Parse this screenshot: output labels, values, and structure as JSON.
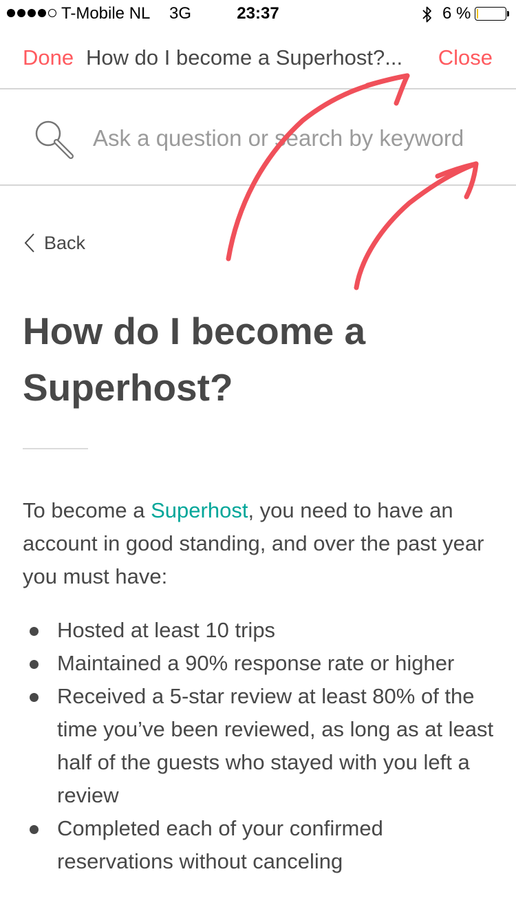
{
  "status_bar": {
    "carrier": "T-Mobile NL",
    "network": "3G",
    "time": "23:37",
    "battery": "6 %",
    "battery_level": 0.06,
    "signal_strength": 4,
    "signal_max": 5,
    "icons": [
      "signal-dots-icon",
      "bluetooth-icon",
      "battery-icon"
    ]
  },
  "nav": {
    "done_label": "Done",
    "title": "How do I become a Superhost?...",
    "close_label": "Close"
  },
  "search": {
    "placeholder": "Ask a question or search by keyword",
    "value": "",
    "icon": "search-icon"
  },
  "back": {
    "label": "Back",
    "icon": "chevron-left-icon"
  },
  "article": {
    "title": "How do I become a Superhost?",
    "intro_before": "To become a ",
    "intro_link": "Superhost",
    "intro_after": ", you need to have an account in good standing, and over the past year you must have:",
    "bullets": [
      "Hosted at least 10 trips",
      "Maintained a 90% response rate or higher",
      "Received a 5-star review at least 80% of the time you’ve been reviewed, as long as at least half of the guests who stayed with you left a review",
      "Completed each of your confirmed reservations without canceling"
    ]
  },
  "colors": {
    "accent": "#ff5a5f",
    "link": "#00a699",
    "text": "#484848",
    "placeholder": "#9b9b9b",
    "divider": "#d6d6d6",
    "annotation": "#f0505a"
  }
}
